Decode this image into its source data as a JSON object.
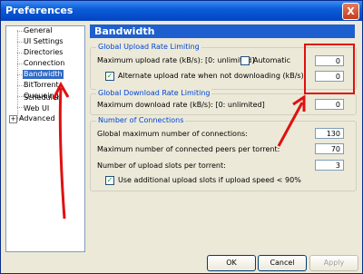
{
  "window": {
    "title": "Preferences",
    "close_glyph": "X"
  },
  "tree": {
    "items": [
      "General",
      "UI Settings",
      "Directories",
      "Connection",
      "Bandwidth",
      "BitTorrent",
      "Queueing",
      "Scheduler",
      "Web UI",
      "Advanced"
    ],
    "selected": "Bandwidth",
    "expander_glyph": "+"
  },
  "panel": {
    "title": "Bandwidth"
  },
  "upload_group": {
    "legend": "Global Upload Rate Limiting",
    "max_label": "Maximum upload rate (kB/s): [0: unlimited]",
    "automatic_label": "Automatic",
    "automatic_checked": false,
    "max_value": "0",
    "alt_checked": true,
    "alt_label": "Alternate upload rate when not downloading (kB/s):",
    "alt_value": "0"
  },
  "download_group": {
    "legend": "Global Download Rate Limiting",
    "max_label": "Maximum download rate (kB/s): [0: unlimited]",
    "max_value": "0"
  },
  "connections_group": {
    "legend": "Number of Connections",
    "global_label": "Global maximum number of connections:",
    "global_value": "130",
    "peers_label": "Maximum number of connected peers per torrent:",
    "peers_value": "70",
    "slots_label": "Number of upload slots per torrent:",
    "slots_value": "3",
    "extra_checked": true,
    "extra_label": "Use additional upload slots if upload speed < 90%"
  },
  "buttons": {
    "ok": "OK",
    "cancel": "Cancel",
    "apply": "Apply"
  },
  "check_glyph": "✓",
  "colors": {
    "accent": "#1e5fd0",
    "selection": "#316ac5",
    "annotation": "#e01010",
    "title_bar": "#0b5ed9"
  }
}
